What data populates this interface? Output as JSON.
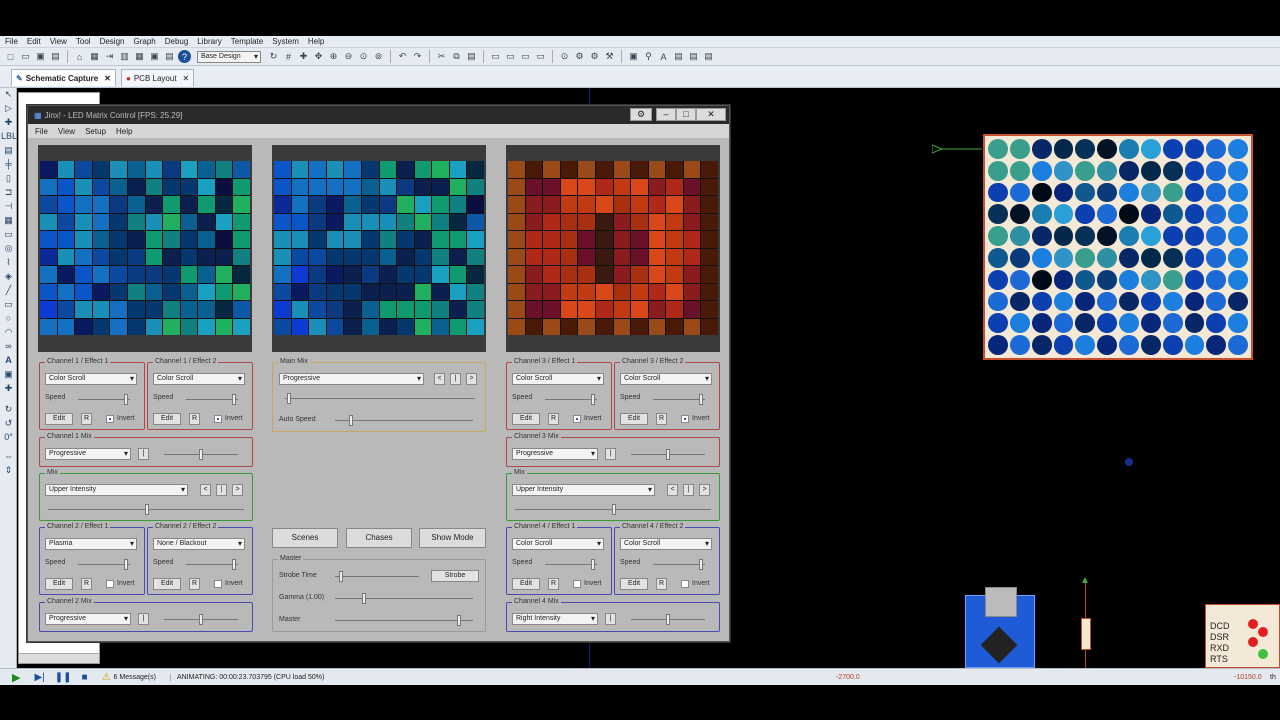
{
  "app": {
    "menu": [
      "File",
      "Edit",
      "View",
      "Tool",
      "Design",
      "Graph",
      "Debug",
      "Library",
      "Template",
      "System",
      "Help"
    ],
    "toolbar_dropdown": "Base Design",
    "tabs": [
      {
        "label": "Schematic Capture"
      },
      {
        "label": "PCB Layout"
      }
    ],
    "status": {
      "messages": "6 Message(s)",
      "animating": "ANIMATING: 00:00:23.703795 (CPU load 50%)",
      "coord_x": "-2700.0",
      "coord_y": "-10150.0",
      "unit": "th"
    },
    "led_colors": [
      "#3a9e8c",
      "#2f8fa3",
      "#1a7fb0",
      "#2f93c6",
      "#0e5a90",
      "#0a3a7a",
      "#082766",
      "#08267a",
      "#0c3fb0",
      "#1b6ad6",
      "#1c7fe0",
      "#2aa0d8",
      "#063055",
      "#021325",
      "#000b18",
      "#03294a"
    ]
  },
  "jinx": {
    "title": "Jinx! - LED Matrix Control [FPS: 25.29]",
    "menu": [
      "File",
      "View",
      "Setup",
      "Help"
    ],
    "ch1_effect1": {
      "legend": "Channel 1 / Effect 1",
      "effect": "Color Scroll",
      "speed": "Speed",
      "edit": "Edit",
      "r": "R",
      "invert": "Invert"
    },
    "ch1_effect2": {
      "legend": "Channel 1 / Effect 2",
      "effect": "Color Scroll",
      "speed": "Speed",
      "edit": "Edit",
      "r": "R",
      "invert": "Invert"
    },
    "ch1_mix": {
      "legend": "Channel 1 Mix",
      "mode": "Progressive"
    },
    "mix_left": {
      "legend": "Mix",
      "mode": "Upper Intensity"
    },
    "ch2_effect1": {
      "legend": "Channel 2 / Effect 1",
      "effect": "Plasma",
      "speed": "Speed",
      "edit": "Edit",
      "r": "R",
      "invert": "Invert"
    },
    "ch2_effect2": {
      "legend": "Channel 2 / Effect 2",
      "effect": "None / Blackout",
      "speed": "Speed",
      "edit": "Edit",
      "r": "R",
      "invert": "Invert"
    },
    "ch2_mix": {
      "legend": "Channel 2 Mix",
      "mode": "Progressive"
    },
    "main_mix": {
      "legend": "Main Mix",
      "mode": "Progressive",
      "auto_speed": "Auto Speed"
    },
    "buttons": {
      "scenes": "Scenes",
      "chases": "Chases",
      "show_mode": "Show Mode",
      "prev": "<",
      "pause": "|",
      "next": ">"
    },
    "master": {
      "legend": "Master",
      "strobe_time": "Strobe Time",
      "strobe": "Strobe",
      "gamma": "Gamma (1.00)",
      "master": "Master"
    },
    "ch3_effect1": {
      "legend": "Channel 3 / Effect 1",
      "effect": "Color Scroll",
      "speed": "Speed",
      "edit": "Edit",
      "r": "R",
      "invert": "Invert"
    },
    "ch3_effect2": {
      "legend": "Channel 3 / Effect 2",
      "effect": "Color Scroll",
      "speed": "Speed",
      "edit": "Edit",
      "r": "R",
      "invert": "Invert"
    },
    "ch3_mix": {
      "legend": "Channel 3 Mix",
      "mode": "Progressive"
    },
    "mix_right": {
      "legend": "Mix",
      "mode": "Upper Intensity"
    },
    "ch4_effect1": {
      "legend": "Channel 4 / Effect 1",
      "effect": "Color Scroll",
      "speed": "Speed",
      "edit": "Edit",
      "r": "R",
      "invert": "Invert"
    },
    "ch4_effect2": {
      "legend": "Channel 4 / Effect 2",
      "effect": "Color Scroll",
      "speed": "Speed",
      "edit": "Edit",
      "r": "R",
      "invert": "Invert"
    },
    "ch4_mix": {
      "legend": "Channel 4 Mix",
      "mode": "Right Intensity"
    },
    "palette_blue": [
      "#0a2a9a",
      "#0b3bd0",
      "#0a55c8",
      "#0a1a60",
      "#0b4aa0",
      "#1470c0",
      "#1a8fb8",
      "#0c3a80",
      "#063870",
      "#0a6090",
      "#0c2050",
      "#118080",
      "#0f9a70",
      "#20b060",
      "#1aa0c0",
      "#052840",
      "#0a0f40",
      "#0e58a8"
    ],
    "palette_red": [
      "#4a1a08",
      "#6a2208",
      "#8a2a0a",
      "#a83010",
      "#c23a12",
      "#d84818",
      "#b02818",
      "#8a1c20",
      "#6a1028",
      "#3a1a10",
      "#9a4a18",
      "#5a1010"
    ],
    "channel_colors": {
      "red": "#b04848",
      "blue": "#4a4ab0",
      "green": "#3a9a3a",
      "yellow": "#c8a860"
    }
  },
  "schematic": {
    "pins": [
      "DCD",
      "DSR",
      "RXD",
      "RTS"
    ]
  }
}
